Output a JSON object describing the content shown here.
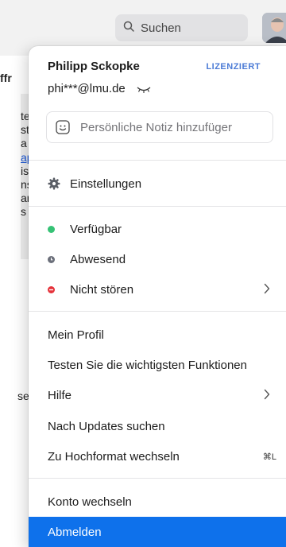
{
  "search": {
    "label": "Suchen"
  },
  "background": {
    "fragments": [
      "ffr",
      "te",
      "st",
      "a",
      "ap",
      "is",
      "ns",
      "ar",
      "s (",
      "se"
    ]
  },
  "profile": {
    "name": "Philipp Sckopke",
    "license": "LIZENZIERT",
    "email": "phi***@lmu.de",
    "note_placeholder": "Persönliche Notiz hinzufüger"
  },
  "menu": {
    "settings": "Einstellungen",
    "status": {
      "available": "Verfügbar",
      "away": "Abwesend",
      "dnd": "Nicht stören"
    },
    "my_profile": "Mein Profil",
    "try_features": "Testen Sie die wichtigsten Funktionen",
    "help": "Hilfe",
    "check_updates": "Nach Updates suchen",
    "portrait": "Zu Hochformat wechseln",
    "portrait_shortcut": "⌘L",
    "switch_account": "Konto wechseln",
    "sign_out": "Abmelden"
  },
  "colors": {
    "accent": "#0e71eb",
    "available": "#36c275",
    "away": "#6b6f7a",
    "dnd": "#e5323a",
    "license": "#4b7bd6"
  }
}
